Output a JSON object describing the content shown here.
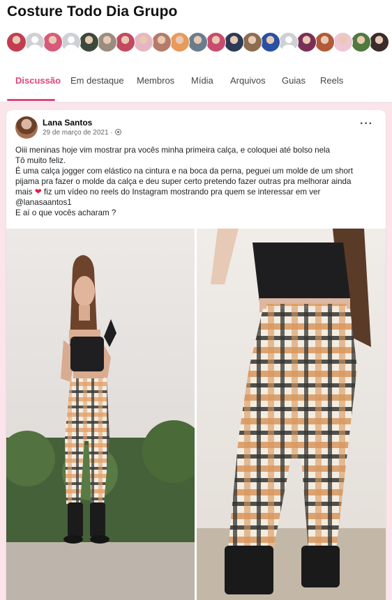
{
  "group": {
    "title": "Costure Todo Dia Grupo"
  },
  "members": {
    "avatars": [
      {
        "kind": "photo",
        "color": "#c23d52"
      },
      {
        "kind": "blank"
      },
      {
        "kind": "photo",
        "color": "#d85a7a"
      },
      {
        "kind": "blank"
      },
      {
        "kind": "photo",
        "color": "#3b4a3a"
      },
      {
        "kind": "photo",
        "color": "#9a8c7e"
      },
      {
        "kind": "photo",
        "color": "#c14a60"
      },
      {
        "kind": "photo",
        "color": "#e6b7c3"
      },
      {
        "kind": "photo",
        "color": "#b57c6a"
      },
      {
        "kind": "photo",
        "color": "#e89a5a"
      },
      {
        "kind": "photo",
        "color": "#6a7d8c"
      },
      {
        "kind": "photo",
        "color": "#c84c6e"
      },
      {
        "kind": "photo",
        "color": "#2d3a55"
      },
      {
        "kind": "photo",
        "color": "#8c6d52"
      },
      {
        "kind": "photo",
        "color": "#2851a3"
      },
      {
        "kind": "blank"
      },
      {
        "kind": "photo",
        "color": "#7a2f56"
      },
      {
        "kind": "photo",
        "color": "#b25a38"
      },
      {
        "kind": "photo",
        "color": "#f0c6d2"
      },
      {
        "kind": "photo",
        "color": "#4f7a3e"
      },
      {
        "kind": "photo",
        "color": "#3a2c2a"
      }
    ]
  },
  "tabs": [
    {
      "label": "Discussão",
      "active": true
    },
    {
      "label": "Em destaque",
      "active": false
    },
    {
      "label": "Membros",
      "active": false
    },
    {
      "label": "Mídia",
      "active": false
    },
    {
      "label": "Arquivos",
      "active": false
    },
    {
      "label": "Guias",
      "active": false
    },
    {
      "label": "Reels",
      "active": false
    }
  ],
  "post": {
    "author": "Lana Santos",
    "date": "29 de março de 2021 ·",
    "more": "···",
    "lines": [
      "Oiii meninas hoje vim mostrar pra vocês minha primeira calça, e coloquei até bolso nela",
      "Tô muito feliz.",
      "É uma calça jogger com elástico na cintura e na boca da perna, peguei um molde de um short",
      "pijama pra fazer o molde da calça e deu super certo pretendo fazer outras pra melhorar ainda"
    ],
    "line5_before": "mais",
    "heart": "❤️",
    "line5_after": "fiz um vídeo no reels do Instagram mostrando pra quem se interessar em ver",
    "line6": "@lanasaantos1",
    "line7": "E aí o que vocês acharam ?"
  },
  "colors": {
    "accent": "#e0457b",
    "feed_background": "#fbe4ea"
  }
}
